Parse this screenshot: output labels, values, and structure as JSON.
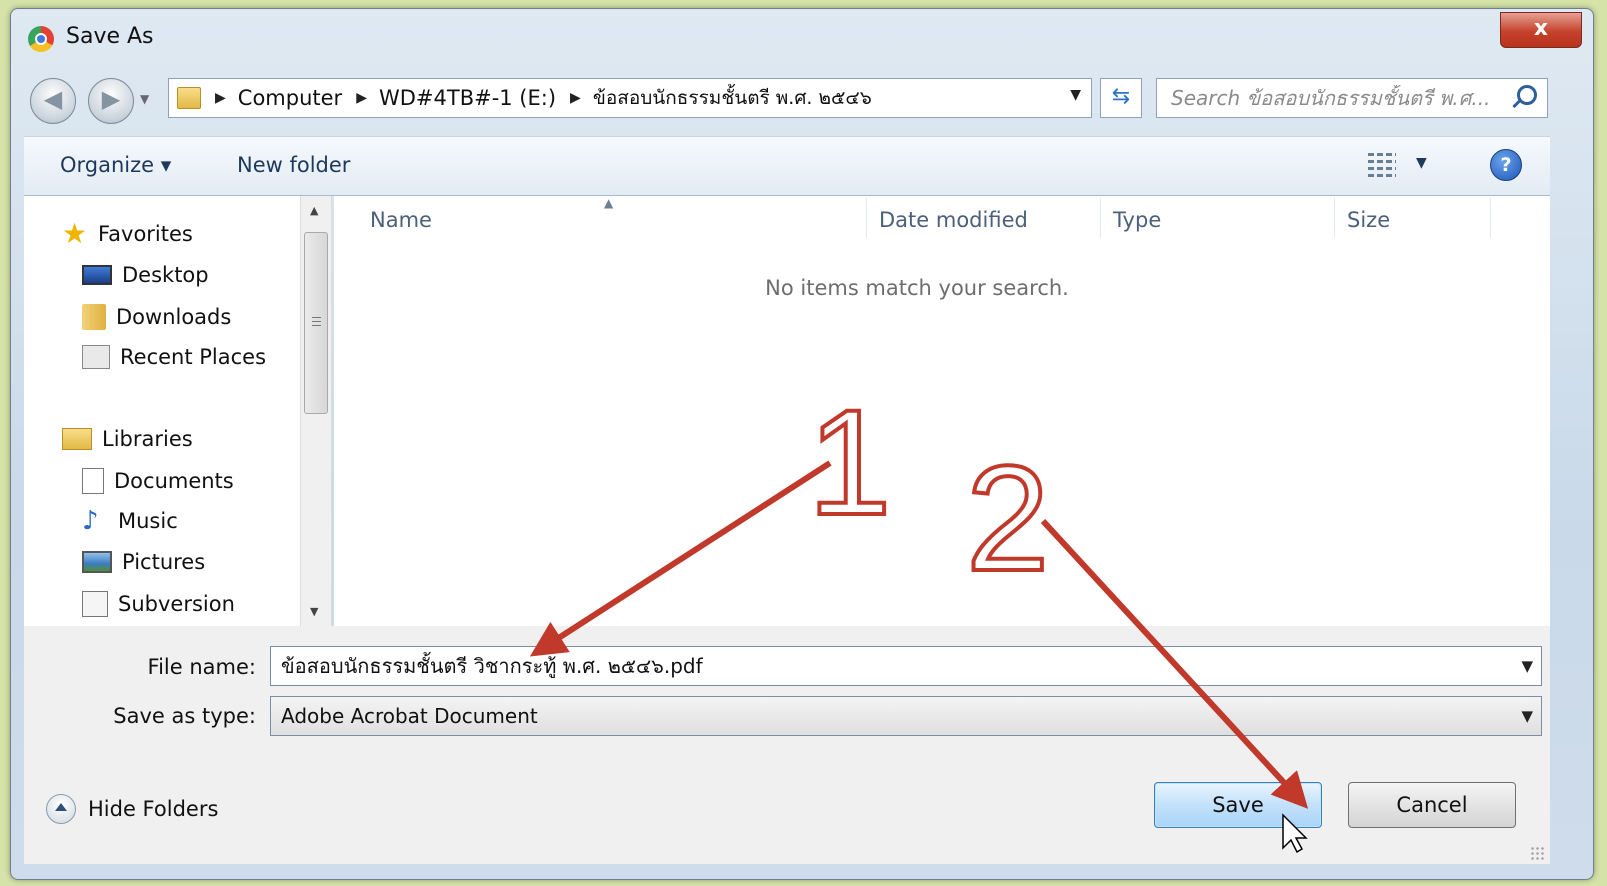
{
  "window": {
    "title": "Save As",
    "close_label": "x"
  },
  "navigation": {
    "back_label": "◀",
    "forward_label": "▶",
    "breadcrumb": [
      "Computer",
      "WD#4TB#-1 (E:)",
      "ข้อสอบนักธรรมชั้นตรี พ.ศ. ๒๕๔๖"
    ],
    "search_placeholder": "Search ข้อสอบนักธรรมชั้นตรี พ.ศ..."
  },
  "toolbar": {
    "organize_label": "Organize ▾",
    "new_folder_label": "New folder",
    "help_label": "?"
  },
  "sidebar": {
    "favorites_label": "Favorites",
    "favorites": [
      "Desktop",
      "Downloads",
      "Recent Places"
    ],
    "libraries_label": "Libraries",
    "libraries": [
      "Documents",
      "Music",
      "Pictures",
      "Subversion"
    ]
  },
  "file_list": {
    "columns": [
      "Name",
      "Date modified",
      "Type",
      "Size"
    ],
    "empty_message": "No items match your search."
  },
  "form": {
    "file_name_label": "File name:",
    "file_name_value": "ข้อสอบนักธรรมชั้นตรี วิชากระทู้ พ.ศ. ๒๕๔๖.pdf",
    "save_type_label": "Save as type:",
    "save_type_value": "Adobe Acrobat Document"
  },
  "footer": {
    "hide_folders_label": "Hide Folders",
    "save_label": "Save",
    "cancel_label": "Cancel"
  },
  "annotations": {
    "step1_label": "1",
    "step2_label": "2",
    "color": "#c0392b"
  }
}
